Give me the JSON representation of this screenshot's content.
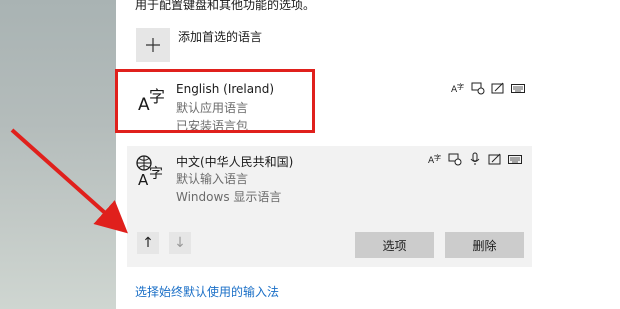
{
  "description_line": "用于配置键盘和其他功能的选项。",
  "add_language": {
    "label": "添加首选的语言"
  },
  "languages": [
    {
      "name": "English (Ireland)",
      "lines": [
        "默认应用语言",
        "已安装语言包"
      ],
      "features": [
        "text-to-speech-icon",
        "speech-recognition-icon",
        "handwriting-icon",
        "keyboard-icon"
      ]
    },
    {
      "name": "中文(中华人民共和国)",
      "lines": [
        "默认输入语言",
        "Windows 显示语言"
      ],
      "features": [
        "text-to-speech-icon",
        "speech-recognition-icon",
        "microphone-icon",
        "handwriting-icon",
        "keyboard-icon"
      ]
    }
  ],
  "buttons": {
    "move_up": "↑",
    "move_down": "↓",
    "options": "选项",
    "remove": "删除"
  },
  "link": {
    "label": "选择始终默认使用的输入法"
  },
  "colors": {
    "accent_link": "#1a6fc7",
    "annotation_red": "#e0201c",
    "selected_bg": "#f2f2f2",
    "button_bg": "#cccccc"
  }
}
